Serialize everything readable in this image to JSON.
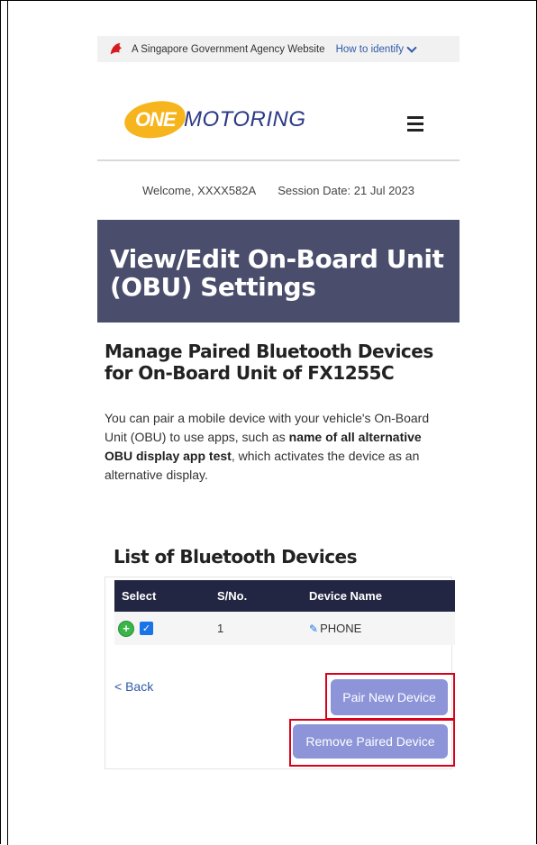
{
  "gov_banner": {
    "text": "A Singapore Government Agency Website",
    "identify_link": "How to identify"
  },
  "header": {
    "logo_one": "ONE",
    "logo_motoring": "MOTORING"
  },
  "welcome": {
    "user": "Welcome, XXXX582A",
    "session": "Session Date: 21 Jul 2023"
  },
  "page": {
    "title": "View/Edit On-Board Unit (OBU) Settings",
    "subtitle": "Manage Paired Bluetooth Devices for On-Board Unit of FX1255C",
    "desc_pre": "You can pair a mobile device with your vehicle's On-Board Unit (OBU) to use apps, such as ",
    "desc_bold": "name of all alternative OBU display app test",
    "desc_post": ", which activates the device as an alternative display.",
    "list_title": "List of Bluetooth Devices"
  },
  "table": {
    "headers": [
      "Select",
      "S/No.",
      "Device Name"
    ],
    "rows": [
      {
        "sno": "1",
        "device": "PHONE"
      }
    ]
  },
  "actions": {
    "back": "< Back",
    "pair": "Pair New Device",
    "remove": "Remove Paired Device"
  },
  "colors": {
    "title_bar": "#4a4d6b",
    "table_header": "#232642",
    "button": "#8d94d8",
    "highlight": "#d9001b"
  }
}
